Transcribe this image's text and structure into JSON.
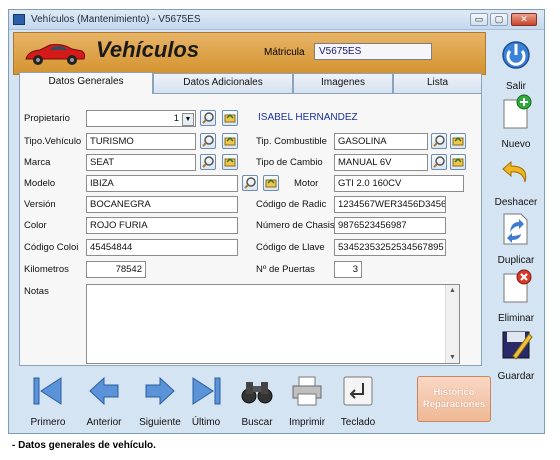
{
  "window": {
    "title": "Vehículos (Mantenimiento) - V5675ES",
    "min_symbol": "▭",
    "max_symbol": "▢",
    "close_symbol": "✕"
  },
  "header": {
    "title": "Vehículos",
    "matricula_label": "Mátricula",
    "matricula_value": "V5675ES"
  },
  "tabs": [
    "Datos Generales",
    "Datos Adicionales",
    "Imagenes",
    "Lista"
  ],
  "form": {
    "propietario_label": "Propietario",
    "propietario_value": "1",
    "propietario_name": "ISABEL HERNANDEZ",
    "tipo_vehiculo_label": "Tipo.Vehículo",
    "tipo_vehiculo_value": "TURISMO",
    "tip_combustible_label": "Tip. Combustible",
    "tip_combustible_value": "GASOLINA",
    "marca_label": "Marca",
    "marca_value": "SEAT",
    "tipo_cambio_label": "Tipo de Cambio",
    "tipo_cambio_value": "MANUAL 6V",
    "modelo_label": "Modelo",
    "modelo_value": "IBIZA",
    "motor_label": "Motor",
    "motor_value": "GTI 2.0 160CV",
    "version_label": "Versión",
    "version_value": "BOCANEGRA",
    "codigo_radio_label": "Código de Radic",
    "codigo_radio_value": "1234567WER3456D3456",
    "color_label": "Color",
    "color_value": "ROJO FURIA",
    "numero_chasis_label": "Número de Chasis",
    "numero_chasis_value": "9876523456987",
    "codigo_color_label": "Código Coloi",
    "codigo_color_value": "45454844",
    "codigo_llave_label": "Código de Llave",
    "codigo_llave_value": "53452353252534567895",
    "kilometros_label": "Kilometros",
    "kilometros_value": "78542",
    "puertas_label": "Nº de Puertas",
    "puertas_value": "3",
    "notas_label": "Notas",
    "notas_value": ""
  },
  "sidebar": {
    "salir": "Salir",
    "nuevo": "Nuevo",
    "deshacer": "Deshacer",
    "duplicar": "Duplicar",
    "eliminar": "Eliminar",
    "guardar": "Guardar"
  },
  "navigation": {
    "primero": "Primero",
    "anterior": "Anterior",
    "siguiente": "Siguiente",
    "ultimo": "Último",
    "buscar": "Buscar",
    "imprimir": "Imprimir",
    "teclado": "Teclado",
    "historico_line1": "Histórico",
    "historico_line2": "Reparaciones"
  },
  "caption": "- Datos generales de vehículo.",
  "colors": {
    "header_bg": "#d4932f",
    "window_bg": "#d5e4f2",
    "accent_blue": "#2b6cc4",
    "owner_text": "#1b2fa0"
  }
}
